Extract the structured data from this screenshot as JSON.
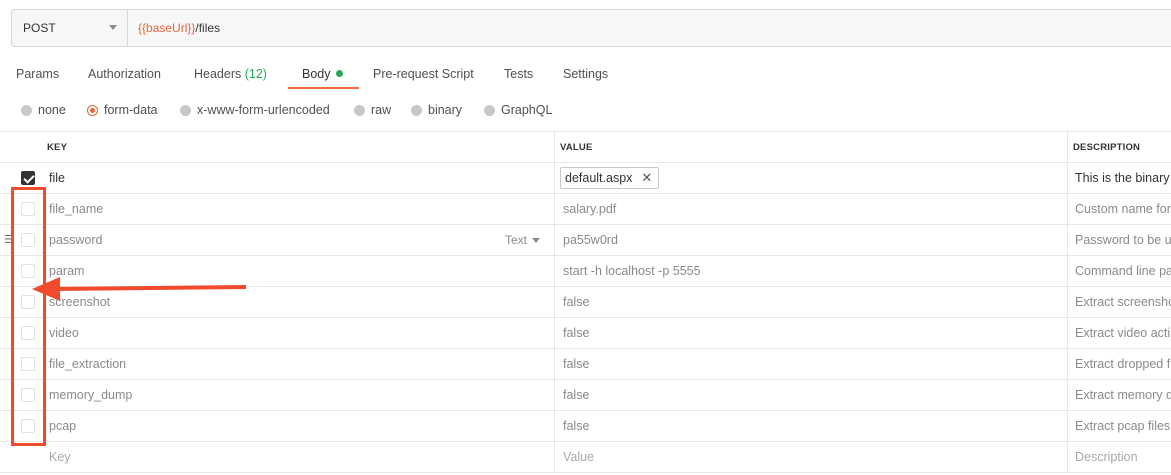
{
  "request": {
    "method": "POST",
    "url_variable": "{{baseUrl}}",
    "url_path": "/files"
  },
  "tabs": [
    {
      "label": "Params"
    },
    {
      "label": "Authorization"
    },
    {
      "label": "Headers",
      "count": "(12)"
    },
    {
      "label": "Body",
      "active": true
    },
    {
      "label": "Pre-request Script"
    },
    {
      "label": "Tests"
    },
    {
      "label": "Settings"
    }
  ],
  "body_modes": [
    {
      "label": "none",
      "selected": false
    },
    {
      "label": "form-data",
      "selected": true
    },
    {
      "label": "x-www-form-urlencoded",
      "selected": false
    },
    {
      "label": "raw",
      "selected": false
    },
    {
      "label": "binary",
      "selected": false
    },
    {
      "label": "GraphQL",
      "selected": false
    }
  ],
  "table": {
    "columns": {
      "key": "KEY",
      "value": "VALUE",
      "description": "DESCRIPTION"
    },
    "rows": [
      {
        "key": "file",
        "value": "default.aspx",
        "description": "This is the binary",
        "enabled": true,
        "value_is_file": true
      },
      {
        "key": "file_name",
        "value": "salary.pdf",
        "description": "Custom name for",
        "enabled": false
      },
      {
        "key": "password",
        "type": "Text",
        "value": "pa55w0rd",
        "description": "Password to be u",
        "enabled": false
      },
      {
        "key": "param",
        "value": "start -h localhost -p 5555",
        "description": "Command line pa",
        "enabled": false
      },
      {
        "key": "screenshot",
        "value": "false",
        "description": "Extract screensho",
        "enabled": false
      },
      {
        "key": "video",
        "value": "false",
        "description": "Extract video acti",
        "enabled": false
      },
      {
        "key": "file_extraction",
        "value": "false",
        "description": "Extract dropped f",
        "enabled": false
      },
      {
        "key": "memory_dump",
        "value": "false",
        "description": "Extract memory d",
        "enabled": false
      },
      {
        "key": "pcap",
        "value": "false",
        "description": "Extract pcap files",
        "enabled": false
      }
    ],
    "placeholder": {
      "key": "Key",
      "value": "Value",
      "description": "Description"
    }
  },
  "colors": {
    "accent": "#f26b3a",
    "variable": "#e8663d",
    "success": "#26a659",
    "annotation": "#f24a2d"
  }
}
